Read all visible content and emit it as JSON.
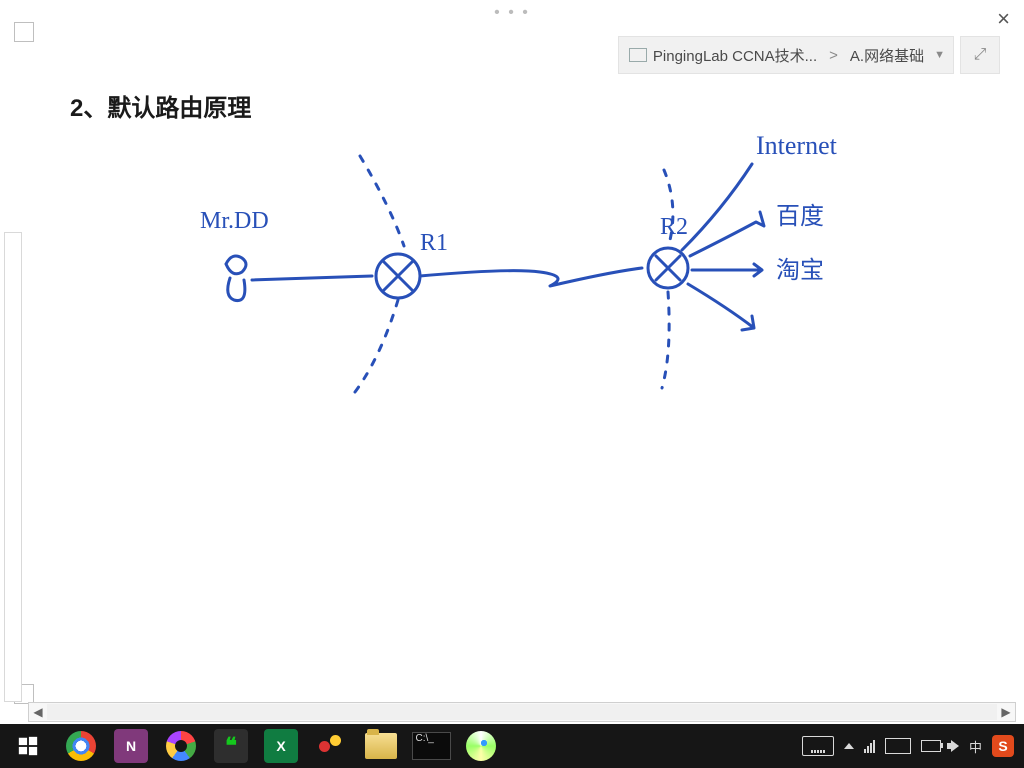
{
  "grip_dots": "• • •",
  "close_label": "×",
  "breadcrumb": {
    "notebook": "PingingLab CCNA技术...",
    "gt": ">",
    "section": "A.网络基础",
    "dropdown_glyph": "▼"
  },
  "expand_glyph": "⤢",
  "heading": "2、默认路由原理",
  "ink_labels": {
    "user": "Mr.DD",
    "r1": "R1",
    "r2": "R2",
    "internet": "Internet",
    "baidu": "百度",
    "taobao": "淘宝"
  },
  "hscroll": {
    "left": "◀",
    "right": "▶"
  },
  "taskbar": {
    "chrome": "Google Chrome",
    "onenote": "N",
    "onenote_title": "OneNote",
    "photos": "Photos",
    "wechat_glyph": "❝",
    "wechat": "WeChat",
    "excel": "X",
    "excel_title": "Excel",
    "apps": "Apps",
    "folder": "Explorer",
    "cmd_prompt": "C:\\_",
    "cmd": "Command Prompt",
    "swirl": "Media"
  },
  "tray": {
    "up": "▲",
    "ime": "中",
    "sogou": "S"
  }
}
